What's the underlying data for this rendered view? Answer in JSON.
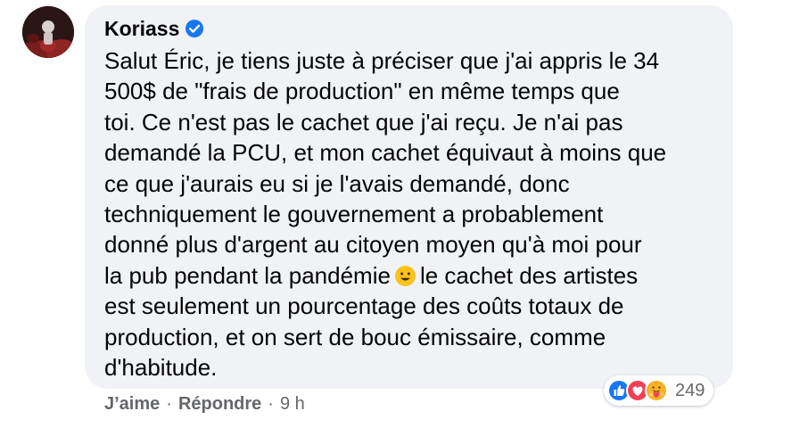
{
  "comment": {
    "author": "Koriass",
    "lines": [
      "Salut Éric, je tiens juste à préciser que j'ai appris le 34",
      "500$ de \"frais de production\" en même temps que",
      "toi. Ce n'est pas le cachet que j'ai reçu. Je n'ai pas",
      "demandé la PCU, et mon cachet équivaut à moins que",
      "ce que j'aurais eu si je l'avais demandé, donc",
      "techniquement le gouvernement a probablement",
      "donné plus d'argent au citoyen moyen qu'à moi pour",
      "la pub pendant la pandémie",
      "le cachet des artistes",
      "est seulement un pourcentage des coûts totaux de",
      "production, et on sert de bouc émissaire, comme",
      "d'habitude."
    ]
  },
  "actions": {
    "like": "J’aime",
    "reply": "Répondre",
    "separator": "·",
    "time": "9 h"
  },
  "reactions": {
    "count": "249",
    "icons": [
      "like-icon",
      "love-icon",
      "care-icon"
    ]
  },
  "colors": {
    "bubble": "#f0f2f5",
    "text": "#050505",
    "muted": "#65676b",
    "verified": "#1877f2",
    "like": "#1877f2",
    "love": "#f33e58",
    "care": "#f7b125"
  }
}
